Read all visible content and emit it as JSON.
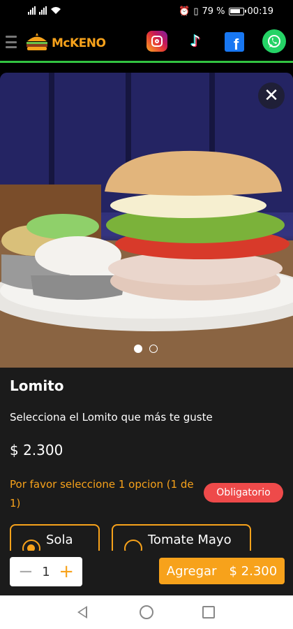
{
  "status_bar": {
    "battery": "79 %",
    "time": "00:19"
  },
  "header": {
    "logo_text": "McKENO",
    "social_icons": [
      "instagram-icon",
      "tiktok-icon",
      "facebook-icon",
      "whatsapp-icon"
    ]
  },
  "product": {
    "name": "Lomito",
    "description": "Selecciona el Lomito que más te guste",
    "price": "$ 2.300",
    "carousel": {
      "total_slides": 2,
      "active_slide": 1
    }
  },
  "options": {
    "prompt": "Por favor seleccione 1 opcion (1 de 1)",
    "required_badge": "Obligatorio",
    "choices": [
      {
        "label": "Sola",
        "selected": true
      },
      {
        "label": "Tomate Mayo",
        "selected": false
      }
    ]
  },
  "cart": {
    "minus": "−",
    "quantity": "1",
    "plus": "+",
    "add_label": "Agregar",
    "add_price": "$ 2.300"
  },
  "colors": {
    "accent": "#f7a21b",
    "badge_red": "#ee4a4a",
    "brand_green": "#33c441",
    "modal_bg": "#1b1b1b"
  }
}
